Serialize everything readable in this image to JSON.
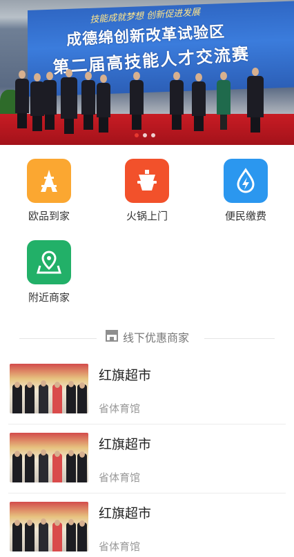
{
  "banner": {
    "slogan": "技能成就梦想 创新促进发展",
    "title_line1": "成德绵创新改革试验区",
    "title_line2": "第二届高技能人才交流赛",
    "slide_count": 3,
    "active_slide": 1
  },
  "categories": [
    {
      "label": "欧品到家",
      "icon": "tower-icon",
      "color": "#fba731"
    },
    {
      "label": "火锅上门",
      "icon": "hotpot-icon",
      "color": "#f2512b"
    },
    {
      "label": "便民缴费",
      "icon": "water-drop-bolt-icon",
      "color": "#2b97ef"
    },
    {
      "label": "附近商家",
      "icon": "map-pin-icon",
      "color": "#22b068"
    }
  ],
  "section": {
    "title": "线下优惠商家",
    "icon": "shop-icon"
  },
  "merchants": [
    {
      "name": "红旗超市",
      "address": "省体育馆"
    },
    {
      "name": "红旗超市",
      "address": "省体育馆"
    },
    {
      "name": "红旗超市",
      "address": "省体育馆"
    }
  ]
}
